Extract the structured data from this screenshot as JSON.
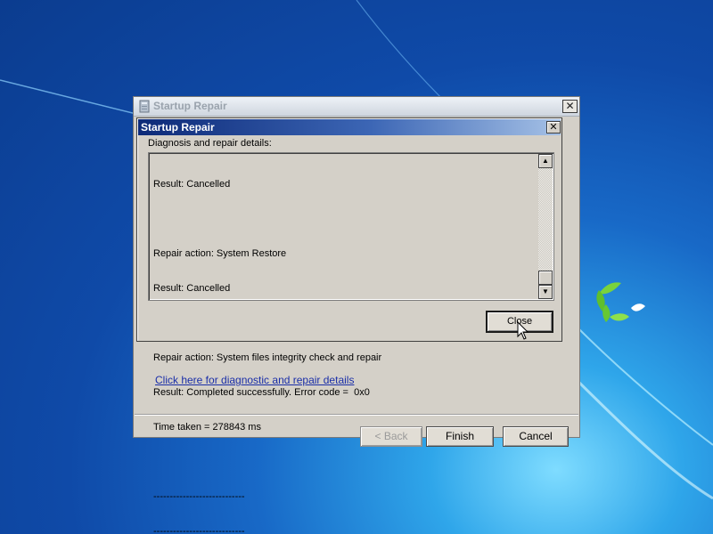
{
  "outer_window": {
    "title": "Startup Repair",
    "close_glyph": "✕",
    "link_text": "Click here for diagnostic and repair details",
    "buttons": {
      "back": "< Back",
      "finish": "Finish",
      "cancel": "Cancel"
    }
  },
  "inner_dialog": {
    "title": "Startup Repair",
    "close_glyph": "✕",
    "label": "Diagnosis and repair details:",
    "details_lines": [
      "Result: Cancelled",
      "",
      "Repair action: System Restore",
      "Result: Cancelled",
      "",
      "Repair action: System files integrity check and repair",
      "Result: Completed successfully. Error code =  0x0",
      "Time taken = 278843 ms",
      "",
      "----------------------------",
      "----------------------------"
    ],
    "close_button": "Close"
  },
  "scrollbar": {
    "up_glyph": "▲",
    "down_glyph": "▼",
    "position": 1.0
  },
  "icons": {
    "app_icon": "startup-repair-icon",
    "cursor": "arrow-cursor-icon"
  },
  "colors": {
    "desktop": "#1869c7",
    "inner_titlebar": "#0d2a78",
    "link": "#1a2ea8",
    "dialog_face": "#d4d0c8"
  }
}
